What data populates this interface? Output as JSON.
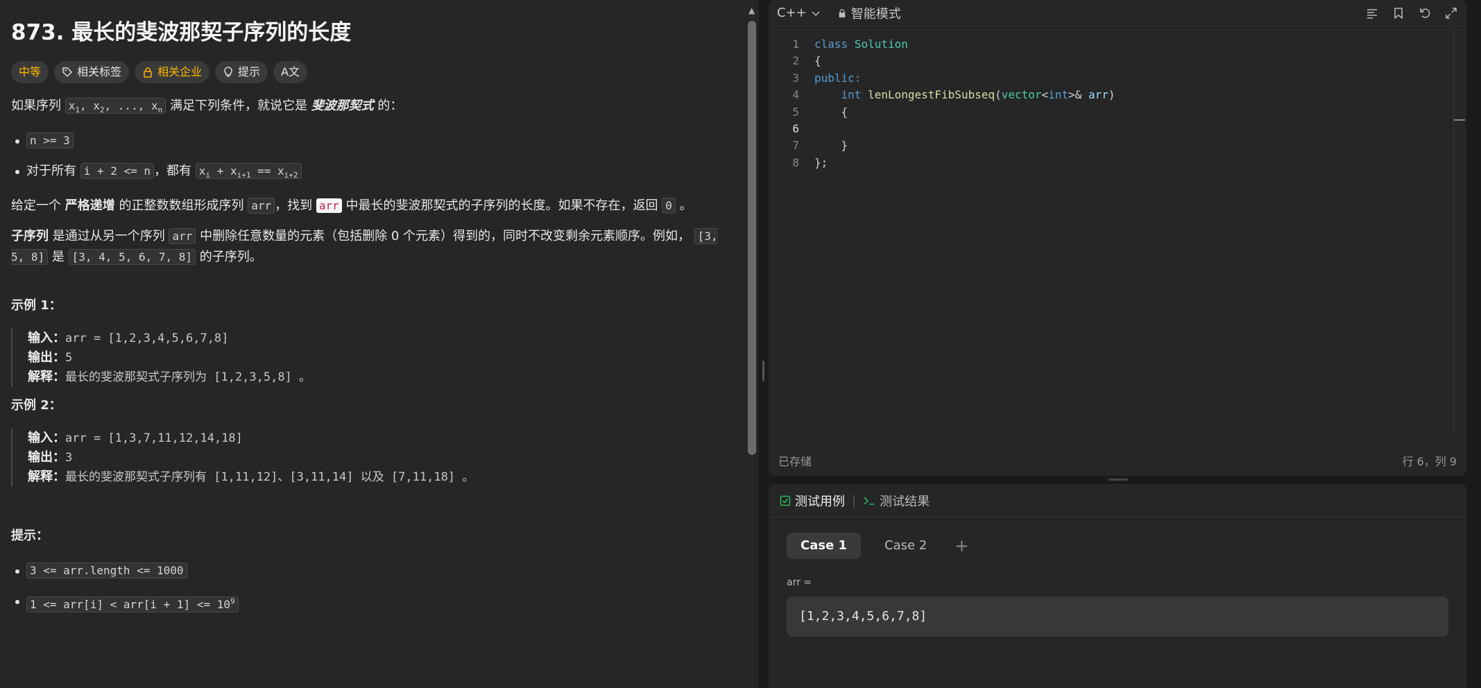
{
  "problem": {
    "title": "873. 最长的斐波那契子序列的长度",
    "tags": {
      "difficulty": "中等",
      "related_tags": "相关标签",
      "related_companies": "相关企业",
      "hint": "提示",
      "translate": "A文"
    },
    "intro_prefix": "如果序列",
    "intro_seq": "x",
    "intro_suffix": "满足下列条件，就说它是",
    "intro_em": "斐波那契式",
    "intro_end": "的：",
    "cond1": "n >= 3",
    "cond2_prefix": "对于所有",
    "cond2_code": "i + 2 <= n",
    "cond2_mid": "，都有",
    "para2_a": "给定一个",
    "para2_strong": "严格递增",
    "para2_b": "的正整数数组形成序列",
    "para2_code1": "arr",
    "para2_c": "，找到",
    "para2_code2": "arr",
    "para2_d": "中最长的斐波那契式的子序列的长度。如果不存在，返回",
    "para2_code3": "0",
    "para2_e": "。",
    "para3_strong": "子序列",
    "para3_a": "是通过从另一个序列",
    "para3_code": "arr",
    "para3_b": "中删除任意数量的元素（包括删除 0 个元素）得到的，同时不改变剩余元素顺序。例如，",
    "para3_code2": "[3, 5, 8]",
    "para3_c": "是",
    "para3_code3": "[3, 4, 5, 6, 7, 8]",
    "para3_d": "的子序列。",
    "example1_title": "示例 1：",
    "example1": {
      "input_k": "输入：",
      "input_v": "arr = [1,2,3,4,5,6,7,8]",
      "output_k": "输出：",
      "output_v": "5",
      "explain_k": "解释：",
      "explain_v": "最长的斐波那契式子序列为 [1,2,3,5,8] 。"
    },
    "example2_title": "示例 2：",
    "example2": {
      "input_k": "输入：",
      "input_v": "arr = [1,3,7,11,12,14,18]",
      "output_k": "输出：",
      "output_v": "3",
      "explain_k": "解释：",
      "explain_v": "最长的斐波那契式子序列有 [1,11,12]、[3,11,14] 以及 [7,11,18] 。"
    },
    "hints_title": "提示：",
    "constraint1": "3 <= arr.length <= 1000",
    "constraint2": "1 <= arr[i] < arr[i + 1] <= 10"
  },
  "editor": {
    "language": "C++",
    "mode": "智能模式",
    "status_saved": "已存储",
    "cursor": "行 6，列 9",
    "lines": [
      "1",
      "2",
      "3",
      "4",
      "5",
      "6",
      "7",
      "8"
    ]
  },
  "tests": {
    "tab_cases": "测试用例",
    "tab_results": "测试结果",
    "case1": "Case 1",
    "case2": "Case 2",
    "param_label": "arr =",
    "param_value": "[1,2,3,4,5,6,7,8]"
  }
}
